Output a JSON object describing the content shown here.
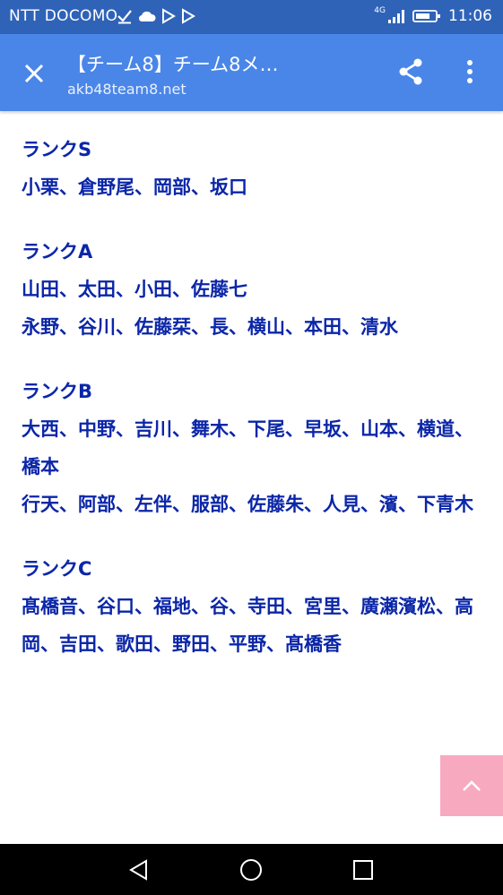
{
  "status_bar": {
    "carrier": "NTT DOCOMO",
    "network_label": "4G",
    "time": "11:06"
  },
  "app_bar": {
    "title": "【チーム8】チーム8メ…",
    "url": "akb48team8.net",
    "bg_color": "#4a86e8"
  },
  "ranks": [
    {
      "heading": "ランクS",
      "lines": [
        "小栗、倉野尾、岡部、坂口"
      ]
    },
    {
      "heading": "ランクA",
      "lines": [
        "山田、太田、小田、佐藤七",
        "永野、谷川、佐藤栞、長、横山、本田、清水"
      ]
    },
    {
      "heading": "ランクB",
      "lines": [
        "大西、中野、吉川、舞木、下尾、早坂、山本、横道、橋本",
        "行天、阿部、左伴、服部、佐藤朱、人見、濱、下青木"
      ]
    },
    {
      "heading": "ランクC",
      "lines": [
        "髙橋音、谷口、福地、谷、寺田、宮里、廣瀬濱松、高岡、吉田、歌田、野田、平野、髙橋香"
      ]
    }
  ],
  "icons": {
    "close": "close-icon",
    "share": "share-icon",
    "more": "more-vert-icon",
    "to_top": "chevron-up-icon",
    "back": "back-triangle-icon",
    "home": "home-circle-icon",
    "recents": "recents-square-icon"
  },
  "colors": {
    "status_bar": "#2f63b8",
    "text": "#0b26a8",
    "to_top_button": "#f7a9c0"
  }
}
